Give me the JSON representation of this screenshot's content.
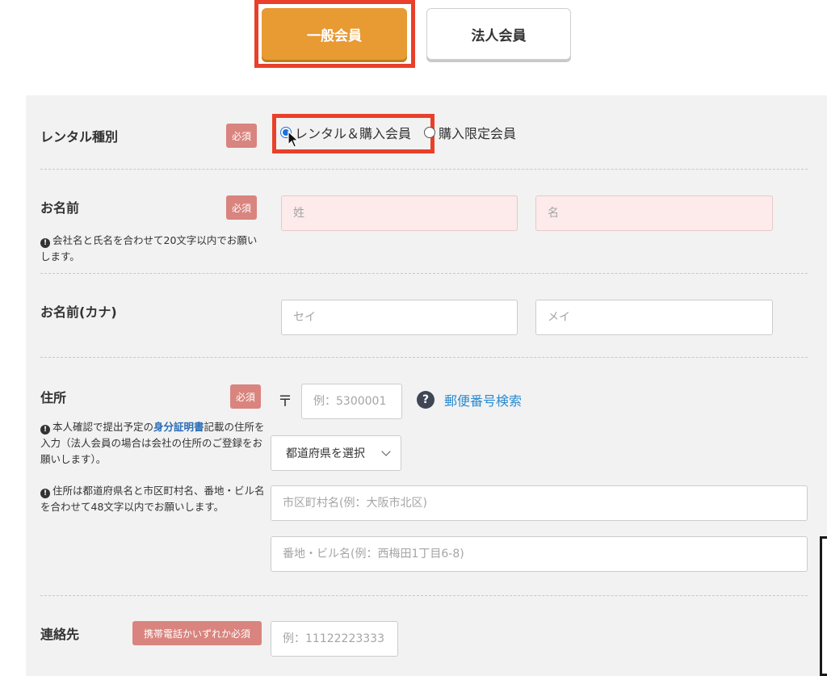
{
  "tabs": {
    "general": "一般会員",
    "corporate": "法人会員"
  },
  "form": {
    "rental_type": {
      "label": "レンタル種別",
      "badge": "必須",
      "options": [
        "レンタル＆購入会員",
        "購入限定会員"
      ],
      "selected": "レンタル＆購入会員"
    },
    "name": {
      "label": "お名前",
      "badge": "必須",
      "note": "会社名と氏名を合わせて20文字以内でお願いします。",
      "last_placeholder": "姓",
      "first_placeholder": "名"
    },
    "kana": {
      "label": "お名前(カナ)",
      "last_placeholder": "セイ",
      "first_placeholder": "メイ"
    },
    "address": {
      "label": "住所",
      "badge": "必須",
      "note1_before": "本人確認で提出予定の",
      "note1_emph": "身分証明書",
      "note1_after": "記載の住所を入力（法人会員の場合は会社の住所のご登録をお願いします）。",
      "note2": "住所は都道府県名と市区町村名、番地・ビル名を合わせて48文字以内でお願いします。",
      "postal_mark": "〒",
      "postal_placeholder": "例：5300001",
      "postal_search": "郵便番号検索",
      "help_glyph": "?",
      "prefecture": "都道府県を選択",
      "city_placeholder": "市区町村名(例：大阪市北区)",
      "street_placeholder": "番地・ビル名(例：西梅田1丁目6-8)"
    },
    "contact": {
      "label": "連絡先",
      "badge": "携帯電話かいずれか必須",
      "phone_placeholder": "例：11122223333"
    }
  },
  "colors": {
    "accent_orange": "#e89a33",
    "highlight_red": "#e8402a",
    "badge_red": "#d9847e",
    "link_blue": "#2a8bd0"
  }
}
